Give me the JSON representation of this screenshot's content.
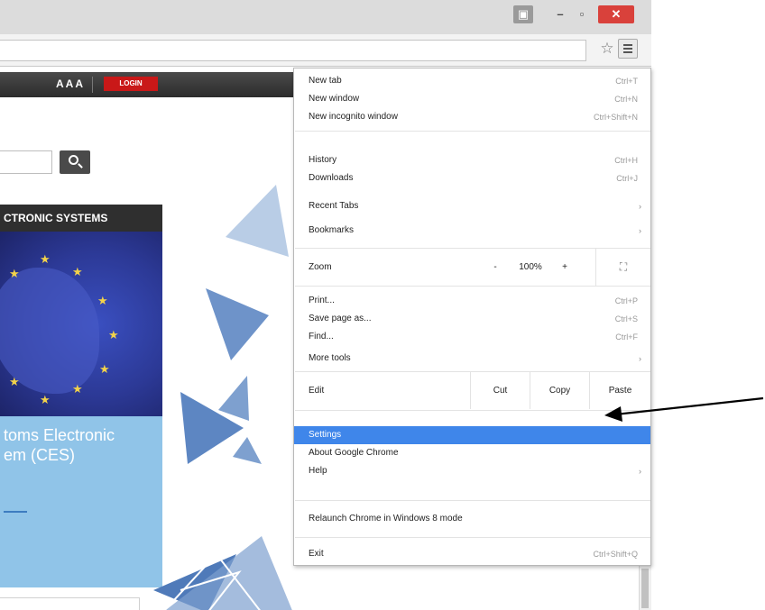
{
  "browser": {
    "window_controls": {
      "user": "▣",
      "minimize": "–",
      "maximize": "▫",
      "close": "✕"
    },
    "toolbar": {
      "star_icon": "☆",
      "menu_icon": "hamburger-icon"
    }
  },
  "site": {
    "header": {
      "font_size_control": "AAA",
      "login_label": "LOGIN"
    },
    "banner_title": "CTRONIC SYSTEMS",
    "ces_text": "toms Electronic\nem (CES)",
    "star_glyph": "★",
    "colors": {
      "banner_dark": "#2f2f2f",
      "map_blue": "#2c3996",
      "panel_blue": "#90c4e8",
      "login_red": "#c91818"
    }
  },
  "menu": {
    "group1": [
      {
        "label": "New tab",
        "shortcut": "Ctrl+T"
      },
      {
        "label": "New window",
        "shortcut": "Ctrl+N"
      },
      {
        "label": "New incognito window",
        "shortcut": "Ctrl+Shift+N"
      }
    ],
    "group2": [
      {
        "label": "History",
        "shortcut": "Ctrl+H",
        "submenu": false
      },
      {
        "label": "Downloads",
        "shortcut": "Ctrl+J",
        "submenu": false
      },
      {
        "label": "Recent Tabs",
        "shortcut": "",
        "submenu": true
      },
      {
        "label": "Bookmarks",
        "shortcut": "",
        "submenu": true
      }
    ],
    "zoom": {
      "label": "Zoom",
      "minus": "-",
      "value": "100%",
      "plus": "+",
      "fullscreen": "⛶"
    },
    "group3": [
      {
        "label": "Print...",
        "shortcut": "Ctrl+P",
        "submenu": false
      },
      {
        "label": "Save page as...",
        "shortcut": "Ctrl+S",
        "submenu": false
      },
      {
        "label": "Find...",
        "shortcut": "Ctrl+F",
        "submenu": false
      },
      {
        "label": "More tools",
        "shortcut": "",
        "submenu": true
      }
    ],
    "edit": {
      "label": "Edit",
      "cut": "Cut",
      "copy": "Copy",
      "paste": "Paste"
    },
    "group4": [
      {
        "label": "Settings",
        "highlighted": true,
        "submenu": false
      },
      {
        "label": "About Google Chrome",
        "highlighted": false,
        "submenu": false
      },
      {
        "label": "Help",
        "highlighted": false,
        "submenu": true
      }
    ],
    "relaunch": "Relaunch Chrome in Windows 8 mode",
    "exit": {
      "label": "Exit",
      "shortcut": "Ctrl+Shift+Q"
    },
    "submenu_arrow": "›",
    "highlight_color": "#3f86ea"
  }
}
